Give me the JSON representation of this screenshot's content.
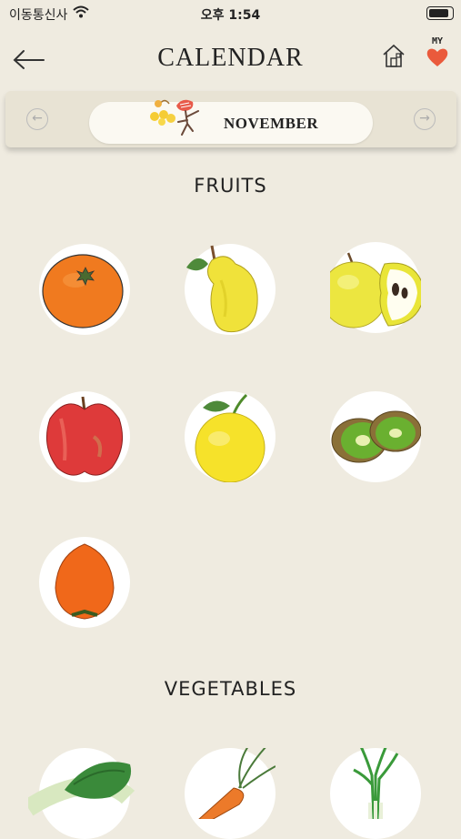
{
  "status_bar": {
    "carrier": "이동통신사",
    "time": "오후 1:54"
  },
  "header": {
    "title": "CALENDAR",
    "my_label": "MY"
  },
  "month_selector": {
    "month": "NOVEMBER"
  },
  "fruits": {
    "title": "FRUITS",
    "items": [
      "orange-icon",
      "quince-icon",
      "pear-icon",
      "apple-icon",
      "yuzu-icon",
      "kiwi-icon",
      "persimmon-icon"
    ]
  },
  "vegetables": {
    "title": "VEGETABLES",
    "items": [
      "napa-cabbage-icon",
      "carrot-icon",
      "green-onion-icon"
    ]
  },
  "colors": {
    "background": "#efebe0",
    "heart": "#ea5a3c"
  }
}
